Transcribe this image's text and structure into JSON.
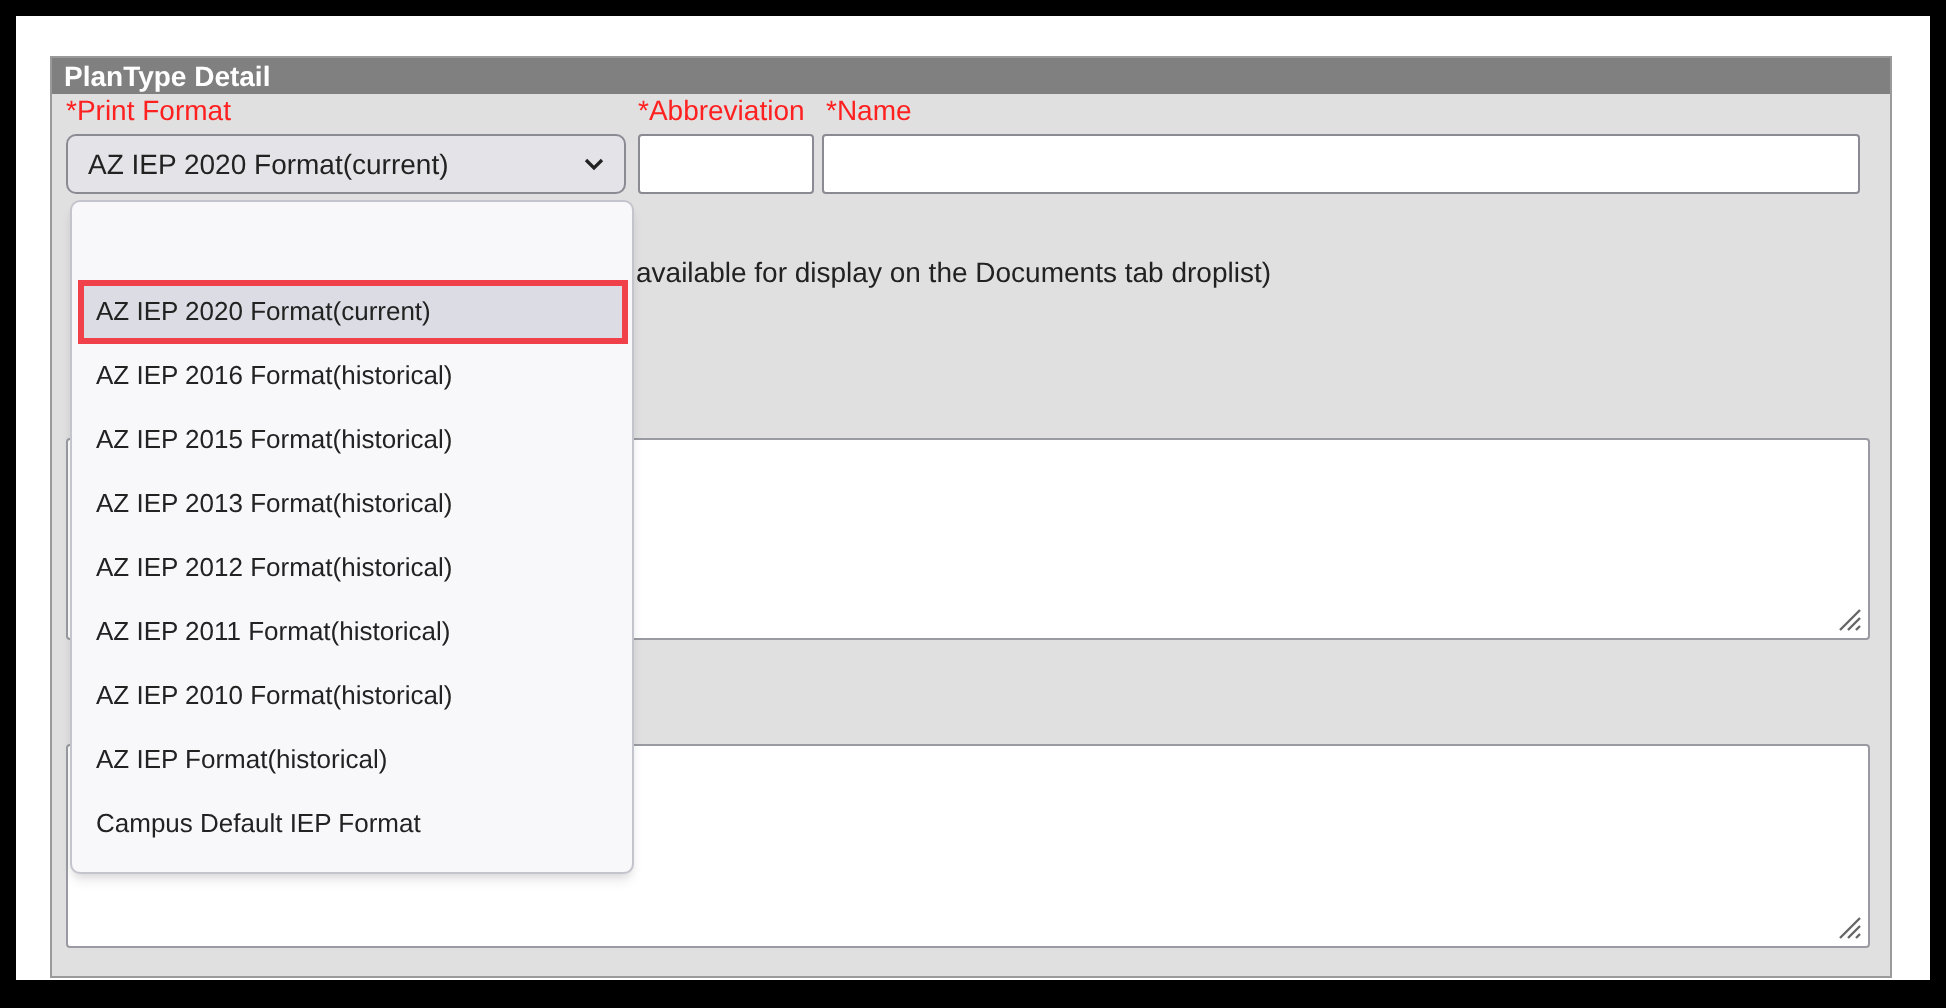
{
  "panel": {
    "title": "PlanType Detail"
  },
  "fields": [
    {
      "label": "*Print Format",
      "kind": "select",
      "value": "AZ IEP 2020 Format(current)"
    },
    {
      "label": "*Abbreviation",
      "kind": "text"
    },
    {
      "label": "*Name",
      "kind": "text"
    }
  ],
  "note": "available for display on the Documents tab droplist)",
  "dropdown": {
    "options": [
      {
        "kind": "option",
        "label": "AZ IEP 2020 Format(current)",
        "selected": true
      },
      {
        "kind": "option",
        "label": "AZ IEP 2016 Format(historical)",
        "selected": false
      },
      {
        "kind": "option",
        "label": "AZ IEP 2015 Format(historical)",
        "selected": false
      },
      {
        "kind": "option",
        "label": "AZ IEP 2013 Format(historical)",
        "selected": false
      },
      {
        "kind": "option",
        "label": "AZ IEP 2012 Format(historical)",
        "selected": false
      },
      {
        "kind": "option",
        "label": "AZ IEP 2011 Format(historical)",
        "selected": false
      },
      {
        "kind": "option",
        "label": "AZ IEP 2010 Format(historical)",
        "selected": false
      },
      {
        "kind": "option",
        "label": "AZ IEP Format(historical)",
        "selected": false
      },
      {
        "kind": "option",
        "label": "Campus Default IEP Format",
        "selected": false
      }
    ]
  }
}
